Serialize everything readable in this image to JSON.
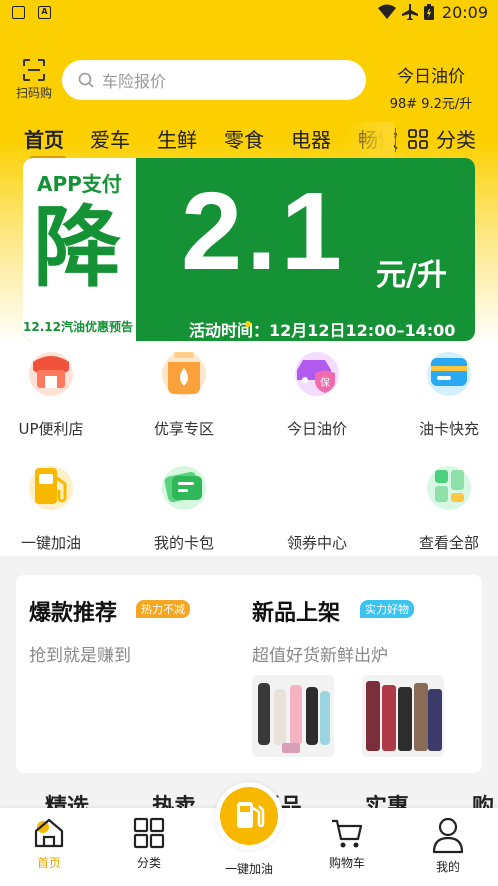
{
  "status_bar": {
    "time": "20:09",
    "app_badge": "A"
  },
  "header": {
    "scan_label": "扫码购",
    "search_placeholder": "车险报价",
    "oil_price_title": "今日油价",
    "oil_price_value": "98# 9.2元/升"
  },
  "tabs": {
    "items": [
      "首页",
      "爱车",
      "生鲜",
      "零食",
      "电器",
      "畅饮"
    ],
    "active_index": 0,
    "category_label": "分类"
  },
  "banner": {
    "app_pay": "APP支付",
    "jiang": "降",
    "preview": "12.12汽油优惠预告",
    "amount": "2.1",
    "unit": "元/升",
    "activity_time": "活动时间：12月12日12:00–14:00",
    "bg_color": "#159136"
  },
  "services": [
    {
      "label": "UP便利店",
      "icon": "store-icon"
    },
    {
      "label": "优享专区",
      "icon": "oil-drop-icon"
    },
    {
      "label": "今日油价",
      "icon": "car-insurance-icon"
    },
    {
      "label": "油卡快充",
      "icon": "card-recharge-icon"
    },
    {
      "label": "一键加油",
      "icon": "fuel-pump-icon"
    },
    {
      "label": "我的卡包",
      "icon": "wallet-icon"
    },
    {
      "label": "领券中心",
      "icon": "coupon-icon"
    },
    {
      "label": "查看全部",
      "icon": "all-apps-icon"
    }
  ],
  "promo": {
    "hot": {
      "title": "爆款推荐",
      "tag": "热力不减",
      "subtitle": "抢到就是赚到",
      "tag_color": "#f5a623"
    },
    "new": {
      "title": "新品上架",
      "tag": "实力好物",
      "subtitle": "超值好货新鲜出炉",
      "tag_color": "#3cc3f0"
    }
  },
  "category_strip": [
    "精选",
    "热卖",
    "新品",
    "实惠",
    "购"
  ],
  "bottom_nav": {
    "items": [
      {
        "label": "首页",
        "icon": "home-icon"
      },
      {
        "label": "分类",
        "icon": "grid-icon"
      },
      {
        "label": "一键加油",
        "icon": "fuel-pump-icon"
      },
      {
        "label": "购物车",
        "icon": "cart-icon"
      },
      {
        "label": "我的",
        "icon": "user-icon"
      }
    ],
    "active_index": 0,
    "accent_color": "#f8b800"
  }
}
